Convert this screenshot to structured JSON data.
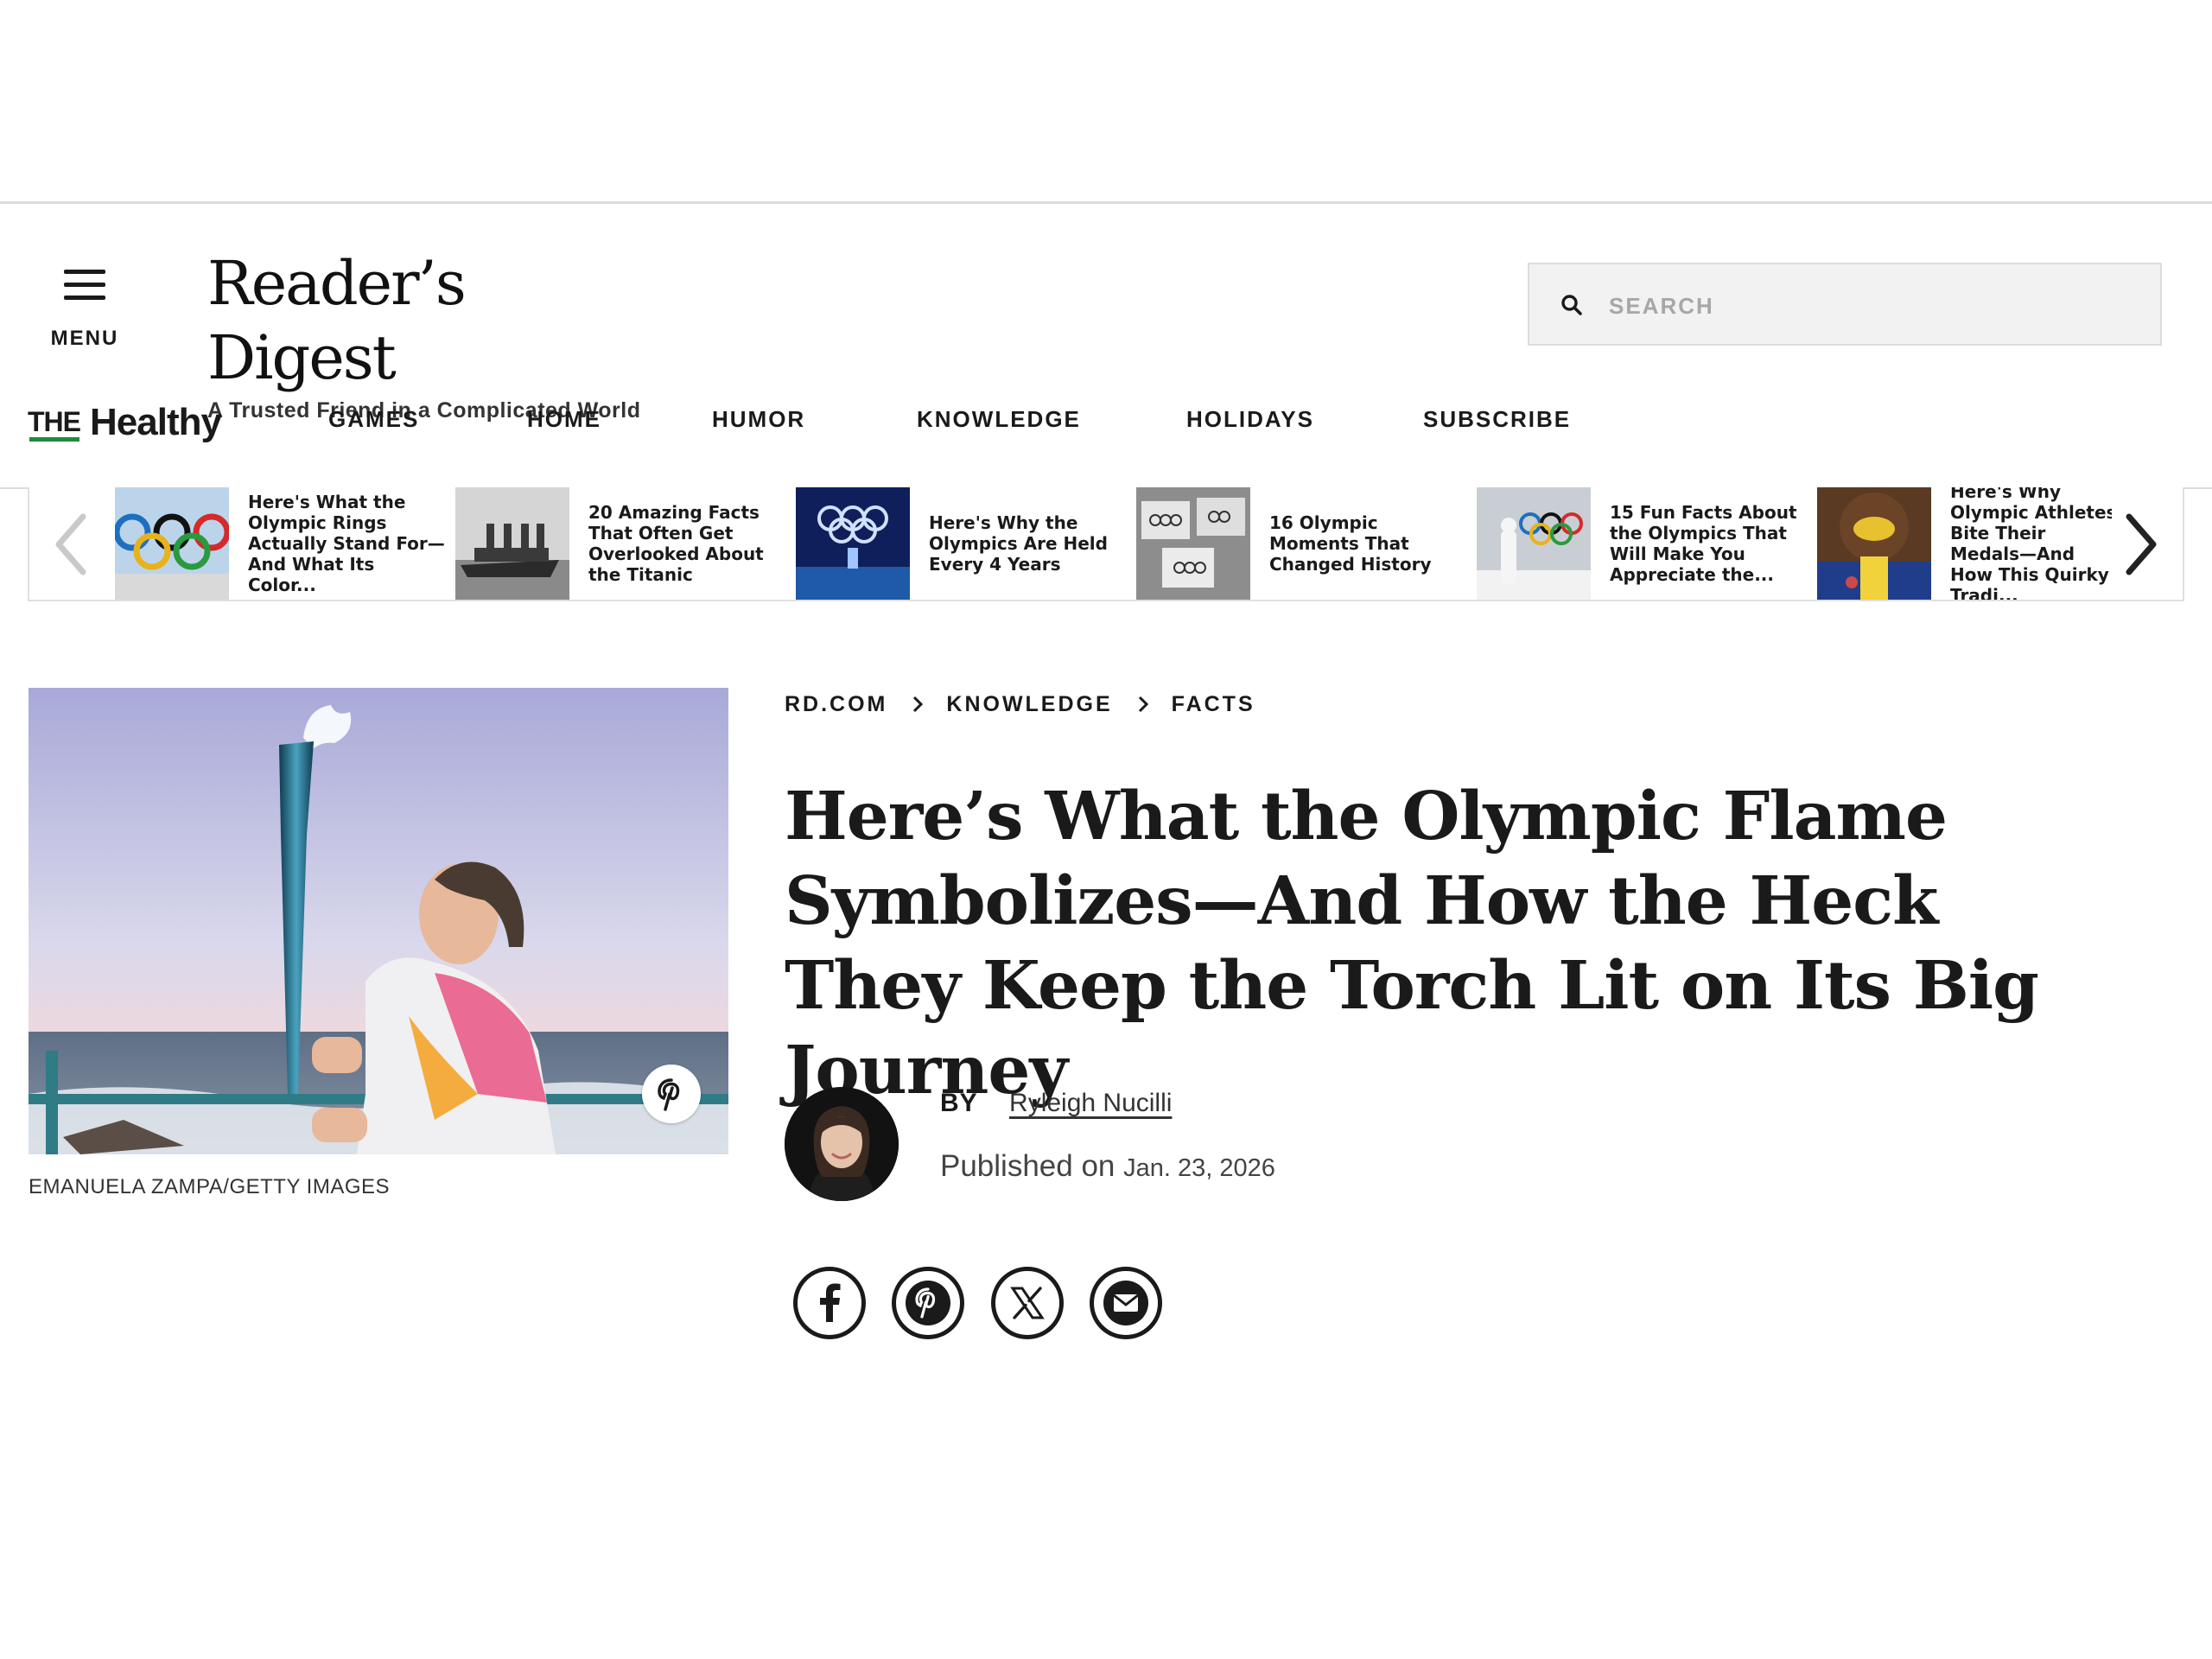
{
  "header": {
    "menu_label": "MENU",
    "logo": "Reader’s Digest",
    "tagline": "A Trusted Friend in a Complicated World",
    "search_placeholder": "SEARCH"
  },
  "nav": {
    "brand_the": "THE",
    "brand_healthy": "Healthy",
    "items": [
      "GAMES",
      "HOME",
      "HUMOR",
      "KNOWLEDGE",
      "HOLIDAYS",
      "SUBSCRIBE"
    ]
  },
  "carousel": {
    "cards": [
      {
        "title": "Here's What the Olympic Rings Actually Stand For—And What Its Color..."
      },
      {
        "title": "20 Amazing Facts That Often Get Overlooked About the Titanic"
      },
      {
        "title": "Here's Why the Olympics Are Held Every 4 Years"
      },
      {
        "title": "16 Olympic Moments That Changed History"
      },
      {
        "title": "15 Fun Facts About the Olympics That Will Make You Appreciate the..."
      },
      {
        "title": "Here's Why Olympic Athletes Bite Their Medals—And How This Quirky Tradi..."
      }
    ]
  },
  "article": {
    "image_credit": "EMANUELA ZAMPA/GETTY IMAGES",
    "breadcrumb": [
      "RD.COM",
      "KNOWLEDGE",
      "FACTS"
    ],
    "headline": "Here’s What the Olympic Flame Symbolizes—And How the Heck They Keep the Torch Lit on Its Big Journey",
    "by_label": "BY",
    "author": "Ryleigh Nucilli",
    "published_label": "Published on",
    "published_date": "Jan. 23, 2026"
  },
  "share": [
    "facebook-icon",
    "pinterest-icon",
    "x-icon",
    "email-icon"
  ],
  "colors": {
    "accent_green": "#1e8a3e",
    "text": "#1a1a1a",
    "search_bg": "#f2f2f2"
  }
}
